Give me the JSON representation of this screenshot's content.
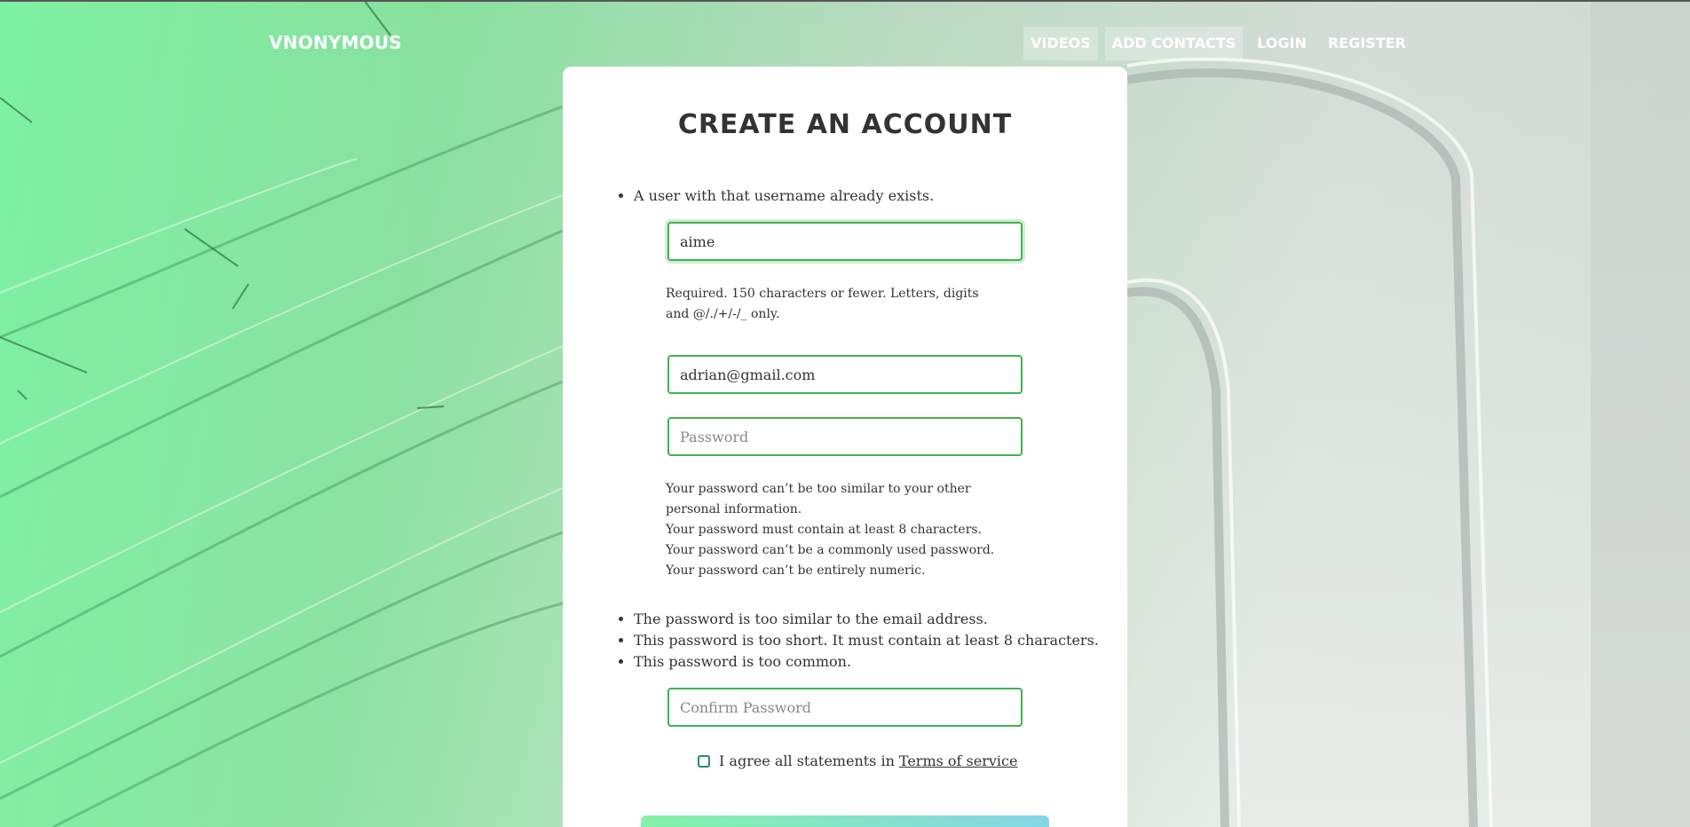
{
  "navbar": {
    "brand": "VNONYMOUS",
    "links": {
      "videos": "VIDEOS",
      "add_contacts": "ADD CONTACTS",
      "login": "LOGIN",
      "register": "REGISTER"
    }
  },
  "form": {
    "title": "CREATE AN ACCOUNT",
    "username": {
      "error": "A user with that username already exists.",
      "value": "aime",
      "help": "Required. 150 characters or fewer. Letters, digits and @/./+/-/_ only."
    },
    "email": {
      "value": "adrian@gmail.com"
    },
    "password": {
      "placeholder": "Password",
      "help": [
        "Your password can’t be too similar to your other personal information.",
        "Your password must contain at least 8 characters.",
        "Your password can’t be a commonly used password.",
        "Your password can’t be entirely numeric."
      ],
      "errors": [
        "The password is too similar to the email address.",
        "This password is too short. It must contain at least 8 characters.",
        "This password is too common."
      ]
    },
    "confirm_password": {
      "placeholder": "Confirm Password"
    },
    "terms": {
      "label": "I agree all statements in",
      "link": "Terms of service"
    }
  },
  "colors": {
    "accent_green": "#41b24f",
    "background_green": "#78f2a0",
    "button_gradient_start": "#84f2a8",
    "button_gradient_end": "#84d6e6"
  }
}
